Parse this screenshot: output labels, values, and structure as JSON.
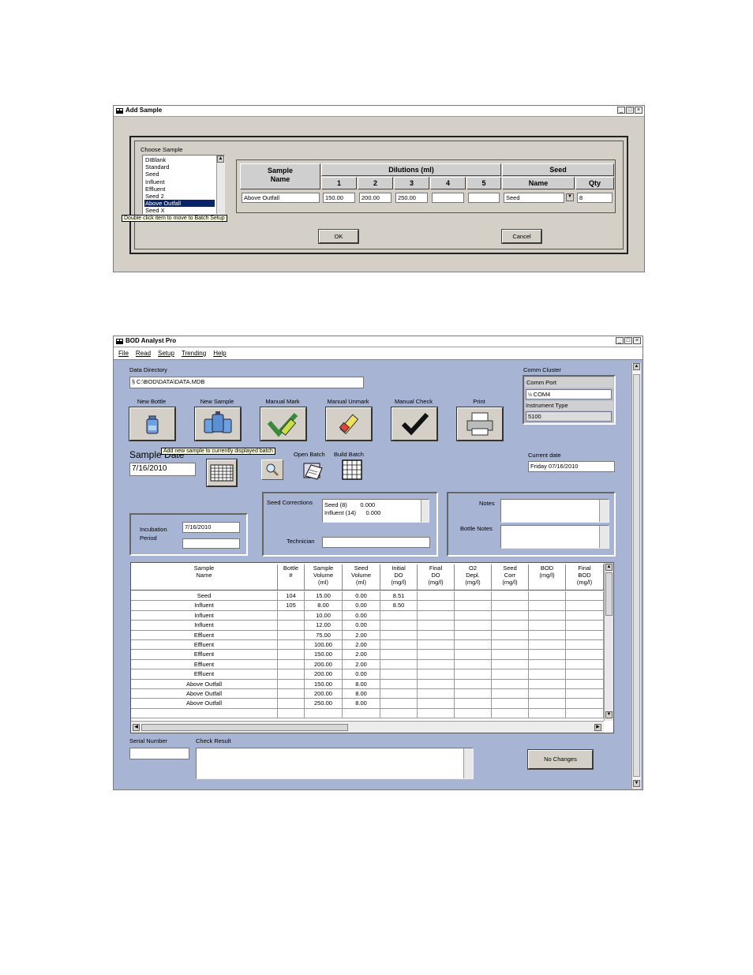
{
  "add_sample": {
    "title": "Add Sample",
    "choose_label": "Choose Sample",
    "list_items": [
      "DIBlank",
      "Standard",
      "Seed",
      "Influent",
      "Effluent",
      "Seed 2",
      "Above Outfall",
      "Seed X"
    ],
    "selected_index": 6,
    "tooltip": "Double click item to move to Batch Setup",
    "headers": {
      "sample_name": "Sample Name",
      "dilutions": "Dilutions (ml)",
      "seed": "Seed",
      "d1": "1",
      "d2": "2",
      "d3": "3",
      "d4": "4",
      "d5": "5",
      "seed_name": "Name",
      "seed_qty": "Qty"
    },
    "row": {
      "sample_name": "Above Outfall",
      "d1": "150.00",
      "d2": "200.00",
      "d3": "250.00",
      "d4": "",
      "d5": "",
      "seed_name": "Seed",
      "seed_qty": "8"
    },
    "ok_label": "OK",
    "cancel_label": "Cancel"
  },
  "main": {
    "title": "BOD Analyst Pro",
    "menu": [
      "File",
      "Read",
      "Setup",
      "Trending",
      "Help"
    ],
    "data_directory_label": "Data Directory",
    "data_directory_value": "C:\\BOD\\DATA\\DATA.MDB",
    "comm_cluster_label": "Comm Cluster",
    "comm_port_label": "Comm Port",
    "comm_port_value": "COM4",
    "instrument_type_label": "Instrument Type",
    "instrument_type_value": "5100",
    "toolbar": {
      "new_bottle": "New Bottle",
      "new_sample": "New Sample",
      "manual_mark": "Manual Mark",
      "manual_unmark": "Manual Unmark",
      "manual_check": "Manual Check",
      "print": "Print"
    },
    "tooltip": "Add new sample to currently displayed batch",
    "sample_date_label": "Sample Date",
    "sample_date_value": "7/16/2010",
    "open_batch_label": "Open Batch",
    "build_batch_label": "Build Batch",
    "current_date_label": "Current date",
    "current_date_value": "Friday 07/16/2010",
    "incubation_label_1": "Incubation",
    "incubation_label_2": "Period",
    "incubation_value": "7/16/2010",
    "seed_corrections_label": "Seed Corrections",
    "seed_corrections_items": [
      "Seed (8)        0.000",
      "Influent (14)      0.000"
    ],
    "technician_label": "Technician",
    "notes_label": "Notes",
    "bottle_notes_label": "Bottle Notes",
    "grid": {
      "headers": [
        [
          "Sample",
          "Name",
          ""
        ],
        [
          "Bottle",
          "#",
          ""
        ],
        [
          "Sample",
          "Volume",
          "(ml)"
        ],
        [
          "Seed",
          "Volume",
          "(ml)"
        ],
        [
          "Initial",
          "DO",
          "(mg/l)"
        ],
        [
          "Final",
          "DO",
          "(mg/l)"
        ],
        [
          "O2",
          "Depl.",
          "(mg/l)"
        ],
        [
          "Seed",
          "Corr",
          "(mg/l)"
        ],
        [
          "BOD",
          "(mg/l)",
          ""
        ],
        [
          "Final",
          "BOD",
          "(mg/l)"
        ]
      ],
      "rows": [
        [
          "Seed",
          "104",
          "15.00",
          "0.00",
          "8.51",
          "",
          "",
          "",
          "",
          ""
        ],
        [
          "Influent",
          "105",
          "8.00",
          "0.00",
          "8.50",
          "",
          "",
          "",
          "",
          ""
        ],
        [
          "Influent",
          "",
          "10.00",
          "0.00",
          "",
          "",
          "",
          "",
          "",
          ""
        ],
        [
          "Influent",
          "",
          "12.00",
          "0.00",
          "",
          "",
          "",
          "",
          "",
          ""
        ],
        [
          "Effluent",
          "",
          "75.00",
          "2.00",
          "",
          "",
          "",
          "",
          "",
          ""
        ],
        [
          "Effluent",
          "",
          "100.00",
          "2.00",
          "",
          "",
          "",
          "",
          "",
          ""
        ],
        [
          "Effluent",
          "",
          "150.00",
          "2.00",
          "",
          "",
          "",
          "",
          "",
          ""
        ],
        [
          "Effluent",
          "",
          "200.00",
          "2.00",
          "",
          "",
          "",
          "",
          "",
          ""
        ],
        [
          "Effluent",
          "",
          "200.00",
          "0.00",
          "",
          "",
          "",
          "",
          "",
          ""
        ],
        [
          "Above Outfall",
          "",
          "150.00",
          "8.00",
          "",
          "",
          "",
          "",
          "",
          ""
        ],
        [
          "Above Outfall",
          "",
          "200.00",
          "8.00",
          "",
          "",
          "",
          "",
          "",
          ""
        ],
        [
          "Above Outfall",
          "",
          "250.00",
          "8.00",
          "",
          "",
          "",
          "",
          "",
          ""
        ],
        [
          "",
          "",
          "",
          "",
          "",
          "",
          "",
          "",
          "",
          ""
        ]
      ]
    },
    "serial_number_label": "Serial Number",
    "check_result_label": "Check Result",
    "no_changes_label": "No Changes"
  },
  "colors": {
    "dialog_bg": "#d4d0c8",
    "main_bg": "#a8b4d4",
    "selection": "#0a246a"
  }
}
